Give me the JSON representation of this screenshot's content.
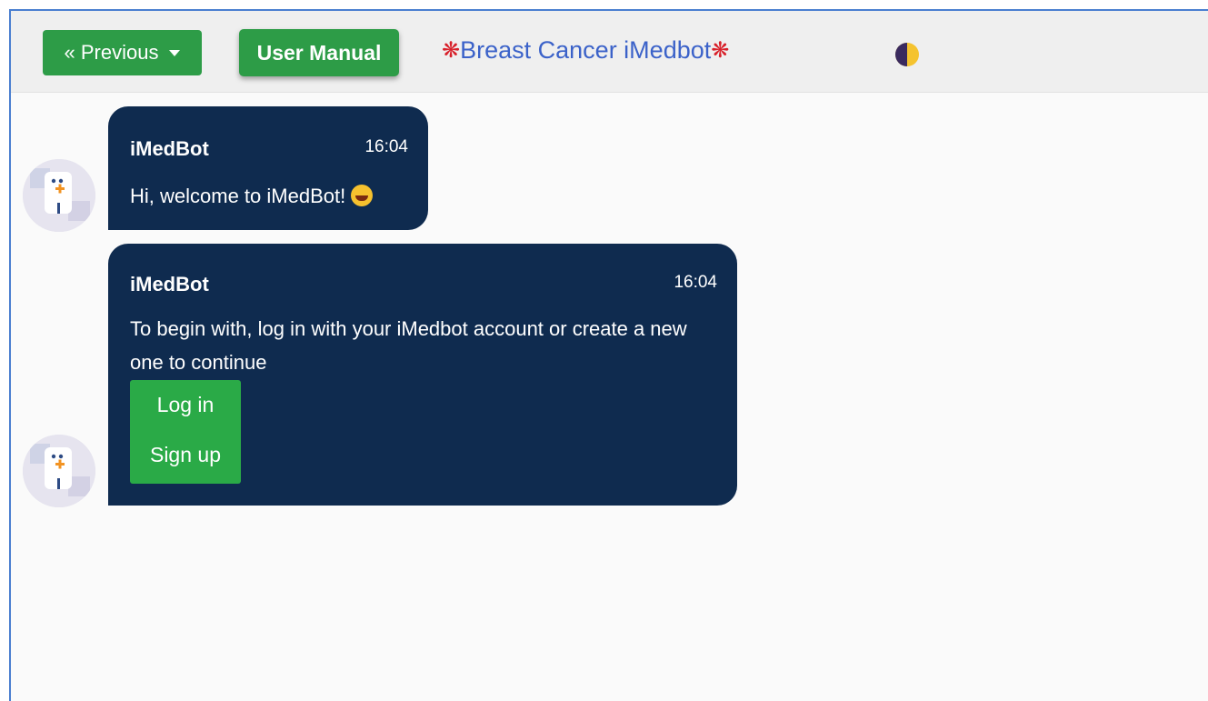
{
  "topbar": {
    "previous_label": "« Previous",
    "manual_label": "User Manual",
    "brand_title": "Breast Cancer iMedbot",
    "theme_toggle_icon": "half-moon-theme-icon"
  },
  "messages": [
    {
      "sender": "iMedBot",
      "time": "16:04",
      "text": "Hi, welcome to iMedBot!",
      "emoji": "grinning-face-icon"
    },
    {
      "sender": "iMedBot",
      "time": "16:04",
      "text": "To begin with, log in with your iMedbot account or create a new one to continue",
      "actions": {
        "login_label": "Log in",
        "signup_label": "Sign up"
      }
    }
  ],
  "colors": {
    "accent_green": "#2d9c47",
    "bubble_navy": "#0f2b4f",
    "brand_blue": "#3b62c9",
    "brand_red": "#d8202a"
  }
}
